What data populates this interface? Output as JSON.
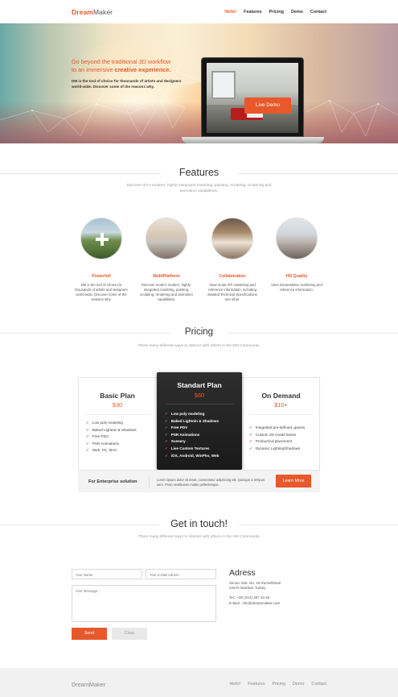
{
  "brand": {
    "logo_part1": "Dream",
    "logo_part2": "Maker",
    "accent": "#e8582a"
  },
  "nav": {
    "items": [
      "Hello!",
      "Features",
      "Pricing",
      "Demo",
      "Contact"
    ],
    "active": "Hello!"
  },
  "hero": {
    "headline_line1": "Go beyond the traditional 3D workflow",
    "headline_line2_prefix": "to an immersive ",
    "headline_line2_bold": "creative experience.",
    "description": "DM is the tool of choice for thousands of artists and designers world-wide. Discover some of the reasons why.",
    "cta_label": "Live Demo"
  },
  "features": {
    "title": "Features",
    "subtitle_line1": "Discover dm’s modern, highly-integrated modeling, painting, sculpting, rendering and",
    "subtitle_line2": "animation capabilities.",
    "items": [
      {
        "title": "Powerfull",
        "desc": "DM is the tool of choice for thousands of artists and designers world-wide. Discover some of the reasons why."
      },
      {
        "title": "MultiPlatform",
        "desc": "Discover mode’s modern, highly-integrated modeling, painting, sculpting, rendering and animation capabilities."
      },
      {
        "title": "Collaboration",
        "desc": "View mode API marketing and reference information, including detailed Technical Specifications and other."
      },
      {
        "title": "HD Quality",
        "desc": "View DreamMaker marketing and reference information."
      }
    ]
  },
  "pricing": {
    "title": "Pricing",
    "subtitle": "There many different ways to interact with others in the DM Community.",
    "plans": [
      {
        "name": "Basic Plan",
        "price": "$30",
        "features": [
          "Low poly modeling",
          "Baked Lightnin & Shadows",
          "Free PDV",
          "PSR Animations",
          "Web, PC, MAC"
        ]
      },
      {
        "name": "Standart Plan",
        "price": "$60",
        "features": [
          "Low poly modeling",
          "Baked Lightnin & Shadows",
          "Free PDV",
          "PSR Animations",
          "Scenery",
          "Live Custom Textures",
          "iOS, Android, WinPho, Web"
        ]
      },
      {
        "name": "On Demand",
        "price": "$10+",
        "features": [
          "Integrated pre-defined, games",
          "Custom 3D model banks",
          "Product/Ad placement",
          "Dynamic Lighting/Shadows"
        ]
      }
    ],
    "enterprise": {
      "label": "For Enterprise solution",
      "text": "Lorem ipsum dolor sit amet, consectetur adipiscing elit. Quisque a tempus sem. Proin vestibulum mattis pellentesque.",
      "button": "Learn More"
    }
  },
  "contact": {
    "title": "Get in touch!",
    "subtitle": "There many different ways to interact with others in the DM Community.",
    "name_placeholder": "Your Name",
    "email_placeholder": "Your E-Mail Adress",
    "message_placeholder": "Your Message...",
    "send_label": "Send",
    "clear_label": "Clear",
    "address_title": "Adress",
    "address_line1": "Sircaci Sok. No. 18 Rumelihisari",
    "address_line2": "34470 Istanbul, Turkey",
    "tel": "Tel.: +90 (212) 257 10 48",
    "email": "E-Mail : info@dreammaker.com"
  },
  "footer": {
    "logo": "DreamMaker",
    "items": [
      "Hello!",
      "Features",
      "Pricing",
      "Demo",
      "Contact"
    ]
  }
}
